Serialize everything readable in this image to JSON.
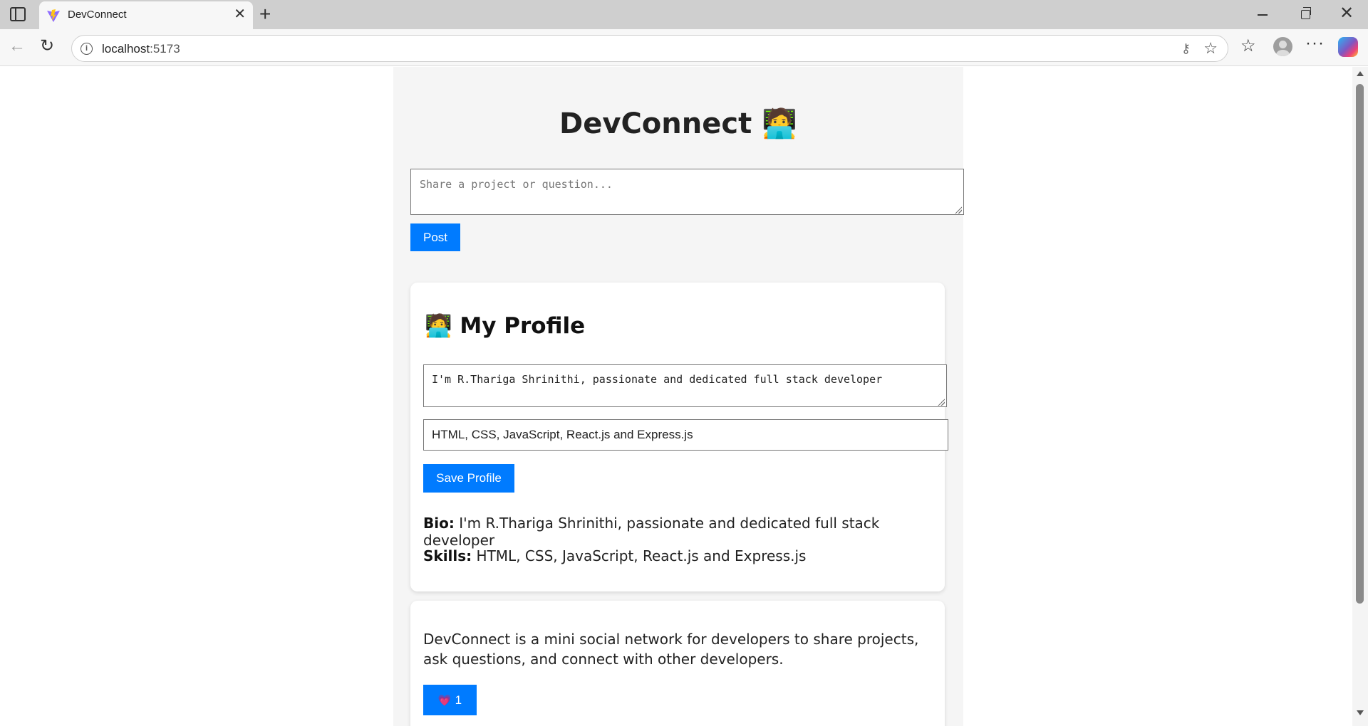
{
  "browser": {
    "tab_title": "DevConnect",
    "url_host": "localhost",
    "url_port": ":5173"
  },
  "app": {
    "title": "DevConnect 🧑‍💻",
    "post_placeholder": "Share a project or question...",
    "post_button": "Post"
  },
  "profile": {
    "heading": "🧑‍💻 My Profile",
    "bio_value": "I'm R.Thariga Shrinithi, passionate and dedicated full stack developer",
    "skills_value": "HTML, CSS, JavaScript, React.js and Express.js",
    "save_button": "Save Profile",
    "bio_label": "Bio:",
    "bio_text": "I'm R.Thariga Shrinithi, passionate and dedicated full stack developer",
    "skills_label": "Skills:",
    "skills_text": "HTML, CSS, JavaScript, React.js and Express.js"
  },
  "posts": [
    {
      "text": "DevConnect is a mini social network for developers to share projects, ask questions, and connect with other developers.",
      "like_icon": "💗",
      "like_count": "1"
    }
  ],
  "colors": {
    "accent": "#007bff",
    "app_background": "#f5f5f5"
  }
}
